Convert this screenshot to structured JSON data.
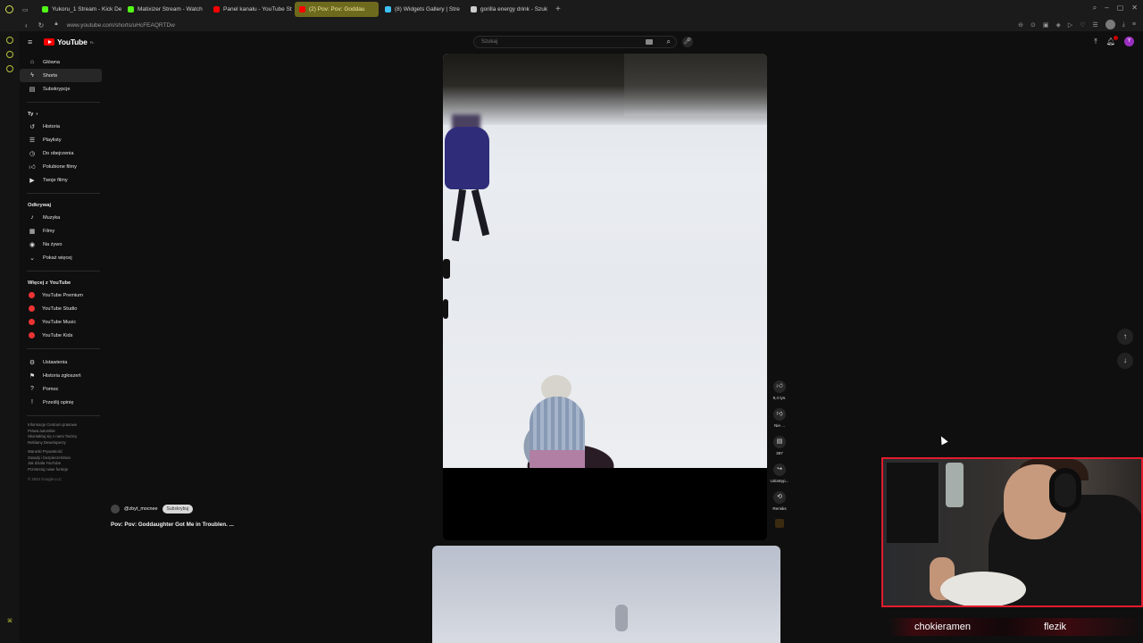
{
  "browser": {
    "tabs": [
      {
        "label": "Yukoru_1 Stream - Kick De",
        "color": "#53fc18",
        "active": false
      },
      {
        "label": "Matixizer Stream - Watch",
        "color": "#53fc18",
        "active": false
      },
      {
        "label": "Panel kanału - YouTube St",
        "color": "#ff0000",
        "active": false
      },
      {
        "label": "(2) Pov: Pov: Goddau",
        "color": "#ff0000",
        "active": true
      },
      {
        "label": "(8) Widgets Gallery | Stre",
        "color": "#3ec1f3",
        "active": false
      },
      {
        "label": "gorilla energy drink - Szuk",
        "color": "#cccccc",
        "active": false
      }
    ],
    "url": "www.youtube.com/shorts/uHcFEAQRTDw"
  },
  "header": {
    "logo_text": "YouTube",
    "logo_region": "PL",
    "search_placeholder": "Szukaj",
    "avatar_letter": "Y"
  },
  "guide": {
    "main": [
      {
        "label": "Główna",
        "icon": "home-icon",
        "selected": false
      },
      {
        "label": "Shorts",
        "icon": "shorts-icon",
        "selected": true
      },
      {
        "label": "Subskrypcje",
        "icon": "subscriptions-icon",
        "selected": false
      }
    ],
    "you_heading": "Ty",
    "you": [
      {
        "label": "Historia",
        "icon": "history-icon"
      },
      {
        "label": "Playlisty",
        "icon": "playlists-icon"
      },
      {
        "label": "Do obejrzenia",
        "icon": "watch-later-icon"
      },
      {
        "label": "Polubione filmy",
        "icon": "like-icon"
      },
      {
        "label": "Twoje filmy",
        "icon": "your-videos-icon"
      }
    ],
    "explore_heading": "Odkrywaj",
    "explore": [
      {
        "label": "Muzyka",
        "icon": "music-icon"
      },
      {
        "label": "Filmy",
        "icon": "movies-icon"
      },
      {
        "label": "Na żywo",
        "icon": "live-icon"
      },
      {
        "label": "Pokaż więcej",
        "icon": "chevron-down-icon"
      }
    ],
    "more_heading": "Więcej z YouTube",
    "more": [
      {
        "label": "YouTube Premium"
      },
      {
        "label": "YouTube Studio"
      },
      {
        "label": "YouTube Music"
      },
      {
        "label": "YouTube Kids"
      }
    ],
    "settings": [
      {
        "label": "Ustawienia",
        "icon": "gear-icon"
      },
      {
        "label": "Historia zgłoszeń",
        "icon": "flag-icon"
      },
      {
        "label": "Pomoc",
        "icon": "help-icon"
      },
      {
        "label": "Prześlij opinię",
        "icon": "feedback-icon"
      }
    ],
    "footer_lines": [
      "Informacje  Centrum prasowe",
      "Prawa autorskie",
      "Skontaktuj się z nami  Twórcy",
      "Reklamy  Deweloperzy",
      "",
      "Warunki  Prywatność",
      "Zasady i bezpieczeństwo",
      "Jak działa YouTube",
      "Przetestuj nowe funkcje"
    ],
    "copyright": "© 2024 Google LLC"
  },
  "short": {
    "channel": "@zbyt_mocnee",
    "subscribe_label": "Subskrybuj",
    "title": "Pov: Pov: Goddaughter Got Me in Troublen. ...",
    "actions": [
      {
        "name": "like",
        "icon": "thumbs-up-icon",
        "label": "9,4 tys."
      },
      {
        "name": "dislike",
        "icon": "thumbs-down-icon",
        "label": "Nie ..."
      },
      {
        "name": "comments",
        "icon": "comment-icon",
        "label": "387"
      },
      {
        "name": "share",
        "icon": "share-icon",
        "label": "Udostęp..."
      },
      {
        "name": "remix",
        "icon": "remix-icon",
        "label": "Remiks"
      }
    ]
  },
  "webcam": {
    "names": [
      "chokieramen",
      "flezik"
    ]
  },
  "colors": {
    "accent_red": "#ff0000",
    "active_tab": "#6e6a1d",
    "cam_border": "#e21b2d"
  }
}
